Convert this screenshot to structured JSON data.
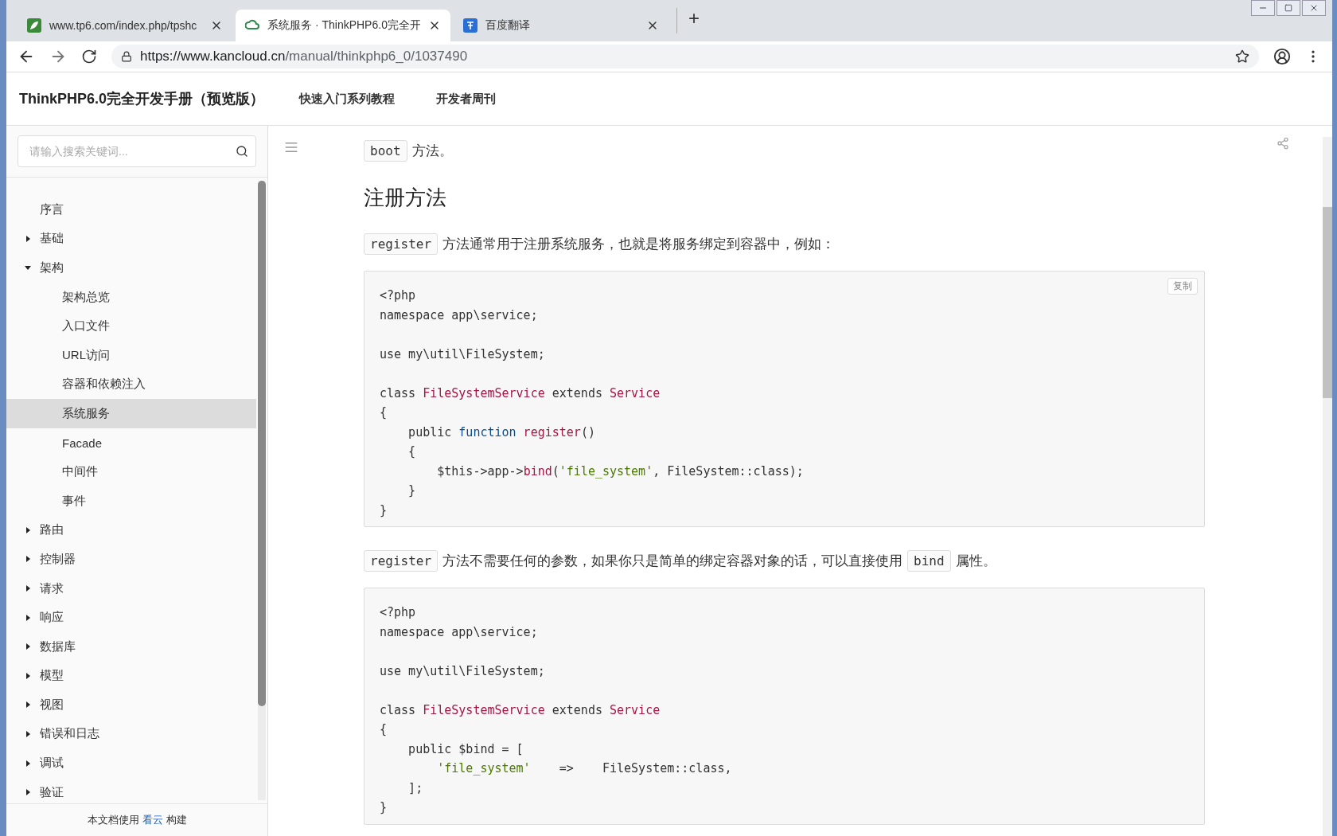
{
  "browser": {
    "tabs": [
      {
        "title": "www.tp6.com/index.php/tpshc",
        "selected": false
      },
      {
        "title": "系统服务 · ThinkPHP6.0完全开",
        "selected": true
      },
      {
        "title": "百度翻译",
        "selected": false
      }
    ],
    "new_tab": "+",
    "url": {
      "host": "https://www.kancloud.cn",
      "path": "/manual/thinkphp6_0/1037490"
    }
  },
  "site": {
    "title": "ThinkPHP6.0完全开发手册（预览版）",
    "nav": [
      "快速入门系列教程",
      "开发者周刊"
    ]
  },
  "sidebar": {
    "search": {
      "placeholder": "请输入搜索关键词..."
    },
    "items": [
      {
        "label": "序言",
        "kind": "leaf",
        "selected": false
      },
      {
        "label": "基础",
        "kind": "group",
        "expanded": false,
        "selected": false
      },
      {
        "label": "架构",
        "kind": "group",
        "expanded": true,
        "selected": false,
        "children": [
          {
            "label": "架构总览",
            "kind": "leaf",
            "selected": false
          },
          {
            "label": "入口文件",
            "kind": "leaf",
            "selected": false
          },
          {
            "label": "URL访问",
            "kind": "leaf",
            "selected": false
          },
          {
            "label": "容器和依赖注入",
            "kind": "leaf",
            "selected": false
          },
          {
            "label": "系统服务",
            "kind": "leaf",
            "selected": true
          },
          {
            "label": "Facade",
            "kind": "leaf",
            "selected": false
          },
          {
            "label": "中间件",
            "kind": "leaf",
            "selected": false
          },
          {
            "label": "事件",
            "kind": "leaf",
            "selected": false
          }
        ]
      },
      {
        "label": "路由",
        "kind": "group",
        "expanded": false,
        "selected": false
      },
      {
        "label": "控制器",
        "kind": "group",
        "expanded": false,
        "selected": false
      },
      {
        "label": "请求",
        "kind": "group",
        "expanded": false,
        "selected": false
      },
      {
        "label": "响应",
        "kind": "group",
        "expanded": false,
        "selected": false
      },
      {
        "label": "数据库",
        "kind": "group",
        "expanded": false,
        "selected": false
      },
      {
        "label": "模型",
        "kind": "group",
        "expanded": false,
        "selected": false
      },
      {
        "label": "视图",
        "kind": "group",
        "expanded": false,
        "selected": false
      },
      {
        "label": "错误和日志",
        "kind": "group",
        "expanded": false,
        "selected": false
      },
      {
        "label": "调试",
        "kind": "group",
        "expanded": false,
        "selected": false
      },
      {
        "label": "验证",
        "kind": "group",
        "expanded": false,
        "selected": false
      }
    ],
    "footer": {
      "before": "本文档使用",
      "link": "看云",
      "after": "构建"
    }
  },
  "content": [
    {
      "kind": "paragraph",
      "segments": [
        {
          "kind": "code",
          "text": "boot"
        },
        {
          "kind": "text",
          "text": "方法。"
        }
      ]
    },
    {
      "kind": "heading",
      "text": "注册方法"
    },
    {
      "kind": "paragraph",
      "segments": [
        {
          "kind": "code",
          "text": "register"
        },
        {
          "kind": "text",
          "text": "方法通常用于注册系统服务，也就是将服务绑定到容器中，例如："
        }
      ]
    },
    {
      "kind": "codeblock",
      "copy": "复制",
      "lines": [
        {
          "kind": "code",
          "tokens": [
            {
              "kind": "plain",
              "text": "<?php"
            }
          ]
        },
        {
          "kind": "code",
          "tokens": [
            {
              "kind": "plain",
              "text": "namespace app\\service;"
            }
          ]
        },
        {
          "kind": "blank"
        },
        {
          "kind": "code",
          "tokens": [
            {
              "kind": "plain",
              "text": "use my\\util\\FileSystem;"
            }
          ]
        },
        {
          "kind": "blank"
        },
        {
          "kind": "code",
          "tokens": [
            {
              "kind": "plain",
              "text": "class "
            },
            {
              "kind": "class",
              "text": "FileSystemService"
            },
            {
              "kind": "plain",
              "text": " extends "
            },
            {
              "kind": "class",
              "text": "Service"
            }
          ]
        },
        {
          "kind": "code",
          "tokens": [
            {
              "kind": "plain",
              "text": "{"
            }
          ]
        },
        {
          "kind": "code",
          "tokens": [
            {
              "kind": "plain",
              "text": "    public "
            },
            {
              "kind": "keyword",
              "text": "function"
            },
            {
              "kind": "class",
              "text": " register"
            },
            {
              "kind": "plain",
              "text": "()"
            }
          ]
        },
        {
          "kind": "code",
          "tokens": [
            {
              "kind": "plain",
              "text": "    {"
            }
          ]
        },
        {
          "kind": "code",
          "tokens": [
            {
              "kind": "plain",
              "text": "        $this->app->"
            },
            {
              "kind": "class",
              "text": "bind"
            },
            {
              "kind": "plain",
              "text": "("
            },
            {
              "kind": "string",
              "text": "'file_system'"
            },
            {
              "kind": "plain",
              "text": ", FileSystem::class);"
            }
          ]
        },
        {
          "kind": "code",
          "tokens": [
            {
              "kind": "plain",
              "text": "    }"
            }
          ]
        },
        {
          "kind": "code",
          "tokens": [
            {
              "kind": "plain",
              "text": "}"
            }
          ]
        }
      ]
    },
    {
      "kind": "paragraph",
      "segments": [
        {
          "kind": "code",
          "text": "register"
        },
        {
          "kind": "text",
          "text": "方法不需要任何的参数，如果你只是简单的绑定容器对象的话，可以直接使用"
        },
        {
          "kind": "code",
          "text": "bind"
        },
        {
          "kind": "text",
          "text": "属性。"
        }
      ]
    },
    {
      "kind": "codeblock",
      "lines": [
        {
          "kind": "code",
          "tokens": [
            {
              "kind": "plain",
              "text": "<?php"
            }
          ]
        },
        {
          "kind": "code",
          "tokens": [
            {
              "kind": "plain",
              "text": "namespace app\\service;"
            }
          ]
        },
        {
          "kind": "blank"
        },
        {
          "kind": "code",
          "tokens": [
            {
              "kind": "plain",
              "text": "use my\\util\\FileSystem;"
            }
          ]
        },
        {
          "kind": "blank"
        },
        {
          "kind": "code",
          "tokens": [
            {
              "kind": "plain",
              "text": "class "
            },
            {
              "kind": "class",
              "text": "FileSystemService"
            },
            {
              "kind": "plain",
              "text": " extends "
            },
            {
              "kind": "class",
              "text": "Service"
            }
          ]
        },
        {
          "kind": "code",
          "tokens": [
            {
              "kind": "plain",
              "text": "{"
            }
          ]
        },
        {
          "kind": "code",
          "tokens": [
            {
              "kind": "plain",
              "text": "    public $bind = ["
            }
          ]
        },
        {
          "kind": "code",
          "tokens": [
            {
              "kind": "string",
              "text": "        'file_system'"
            },
            {
              "kind": "plain",
              "text": "    =>    FileSystem::class,"
            }
          ]
        },
        {
          "kind": "code",
          "tokens": [
            {
              "kind": "plain",
              "text": "    ];"
            }
          ]
        },
        {
          "kind": "code",
          "tokens": [
            {
              "kind": "plain",
              "text": "}"
            }
          ]
        }
      ]
    }
  ]
}
